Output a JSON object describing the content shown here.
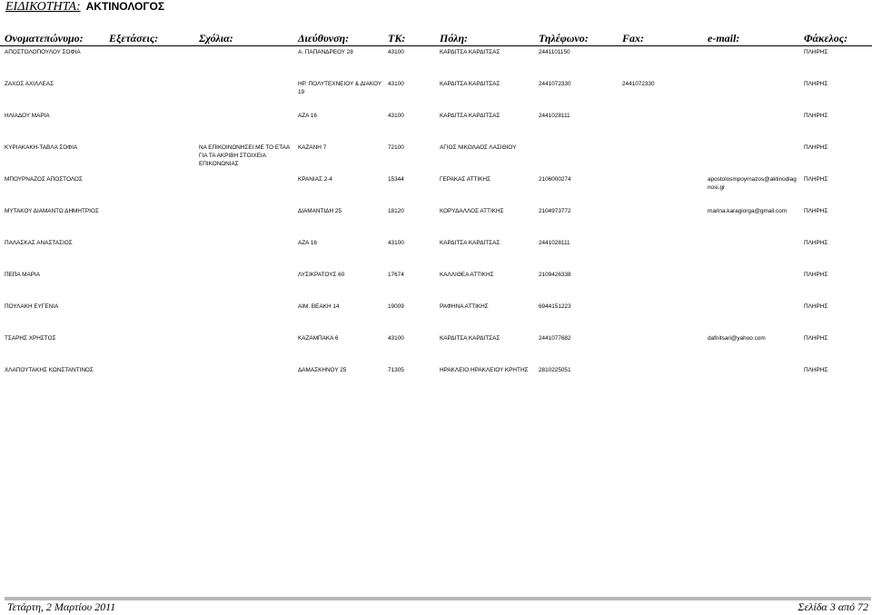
{
  "title": {
    "label": "ΕΙΔΙΚΟΤΗΤΑ:",
    "value": "ΑΚΤΙΝΟΛΟΓΟΣ"
  },
  "columns": {
    "name": "Ονοματεπώνυμο:",
    "exams": "Εξετάσεις:",
    "comments": "Σχόλια:",
    "address": "Διεύθυνση:",
    "tk": "ΤΚ:",
    "city": "Πόλη:",
    "phone": "Τηλέφωνο:",
    "fax": "Fax:",
    "email": "e-mail:",
    "folder": "Φάκελος:"
  },
  "rows": [
    {
      "name": "ΑΠΟΣΤΟΛΟΠΟΥΛΟΥ ΣΟΦΙΑ",
      "comments": "",
      "address": "Α. ΠΑΠΑΝΔΡΕΟΥ 28",
      "tk": "43100",
      "city": "ΚΑΡΔΙΤΣΑ ΚΑΡΔΙΤΣΑΣ",
      "phone": "2441101150",
      "fax": "",
      "email": "",
      "folder": "ΠΛΗΡΗΣ"
    },
    {
      "name": "ΖΑΧΟΣ ΑΧΙΛΛΕΑΣ",
      "comments": "",
      "address": "ΗΡ. ΠΟΛΥΤΕΧΝΕΙΟΥ & ΔΙΑΚΟΥ 19",
      "tk": "43100",
      "city": "ΚΑΡΔΙΤΣΑ ΚΑΡΔΙΤΣΑΣ",
      "phone": "2441072330",
      "fax": "2441072330",
      "email": "",
      "folder": "ΠΛΗΡΗΣ"
    },
    {
      "name": "ΗΛΙΑΔΟΥ ΜΑΡΙΑ",
      "comments": "",
      "address": "ΑΖΑ 16",
      "tk": "43100",
      "city": "ΚΑΡΔΙΤΣΑ ΚΑΡΔΙΤΣΑΣ",
      "phone": "2441028111",
      "fax": "",
      "email": "",
      "folder": "ΠΛΗΡΗΣ"
    },
    {
      "name": "ΚΥΡΙΑΚΑΚΗ-ΤΑΒΛΑ ΣΟΦΙΑ",
      "comments": "ΝΑ ΕΠΙΚΟΙΝΩΝΗΣΕΙ ΜΕ ΤΟ ΕΤΑΑ ΓΙΑ ΤΑ ΑΚΡΙΒΗ ΣΤΟΙΧΕΙΑ ΕΠΙΚΟΝΩΝΙΑΣ",
      "address": "ΚΑΖΑΝΗ 7",
      "tk": "72100",
      "city": "ΑΓΙΟΣ ΝΙΚΟΛΑΟΣ ΛΑΣΙΘΙΟΥ",
      "phone": "",
      "fax": "",
      "email": "",
      "folder": "ΠΛΗΡΗΣ"
    },
    {
      "name": "ΜΠΟΥΡΝΑΖΟΣ ΑΠΟΣΤΟΛΟΣ",
      "comments": "",
      "address": "ΚΡΑΝΙΑΣ 2-4",
      "tk": "15344",
      "city": "ΓΕΡΑΚΑΣ ΑΤΤΙΚΗΣ",
      "phone": "2106000274",
      "fax": "",
      "email": "apostolosmpoyrnazos@aktinodiagnosi.gr",
      "folder": "ΠΛΗΡΗΣ"
    },
    {
      "name": "ΜΥΤΑΚΟΥ ΔΙΑΜΑΝΤΩ ΔΗΜΗΤΡΙΟΣ",
      "comments": "",
      "address": "ΔΙΑΜΑΝΤΙΔΗ 25",
      "tk": "18120",
      "city": "ΚΟΡΥΔΑΛΛΟΣ ΑΤΤΙΚΗΣ",
      "phone": "2104973772",
      "fax": "",
      "email": "marina.karagiorga@gmail.com",
      "folder": "ΠΛΗΡΗΣ"
    },
    {
      "name": "ΠΑΛΑΣΚΑΣ ΑΝΑΣΤΑΣΙΟΣ",
      "comments": "",
      "address": "ΑΖΑ 16",
      "tk": "43100",
      "city": "ΚΑΡΔΙΤΣΑ ΚΑΡΔΙΤΣΑΣ",
      "phone": "2441028111",
      "fax": "",
      "email": "",
      "folder": "ΠΛΗΡΗΣ"
    },
    {
      "name": "ΠΕΠΑ ΜΑΡΙΑ",
      "comments": "",
      "address": "ΛΥΣΙΚΡΑΤΟΥΣ 60",
      "tk": "17674",
      "city": "ΚΑΛΛΙΘΕΑ ΑΤΤΙΚΗΣ",
      "phone": "2109426338",
      "fax": "",
      "email": "",
      "folder": "ΠΛΗΡΗΣ"
    },
    {
      "name": "ΠΟΥΛΑΚΗ ΕΥΓΕΝΙΑ",
      "comments": "",
      "address": "ΑΙΜ. ΒΕΑΚΗ 14",
      "tk": "19009",
      "city": "ΡΑΦΗΝΑ ΑΤΤΙΚΗΣ",
      "phone": "6944151223",
      "fax": "",
      "email": "",
      "folder": "ΠΛΗΡΗΣ"
    },
    {
      "name": "ΤΣΑΡΗΣ ΧΡΗΣΤΟΣ",
      "comments": "",
      "address": "ΚΑΖΑΜΠΑΚΑ 6",
      "tk": "43100",
      "city": "ΚΑΡΔΙΤΣΑ ΚΑΡΔΙΤΣΑΣ",
      "phone": "2441077682",
      "fax": "",
      "email": "dafnitsari@yahoo.com",
      "folder": "ΠΛΗΡΗΣ"
    },
    {
      "name": "ΧΛΑΠΟΥΤΑΚΗΣ ΚΩΝΣΤΑΝΤΙΝΟΣ",
      "comments": "",
      "address": "ΔΑΜΑΣΚΗΝΟΥ 25",
      "tk": "71305",
      "city": "ΗΡΑΚΛΕΙΟ ΗΡΑΚΛΕΙΟΥ ΚΡΗΤΗΣ",
      "phone": "2810225051",
      "fax": "",
      "email": "",
      "folder": "ΠΛΗΡΗΣ"
    }
  ],
  "footer": {
    "date": "Τετάρτη, 2 Μαρτίου 2011",
    "page": "Σελίδα 3 από 72"
  }
}
